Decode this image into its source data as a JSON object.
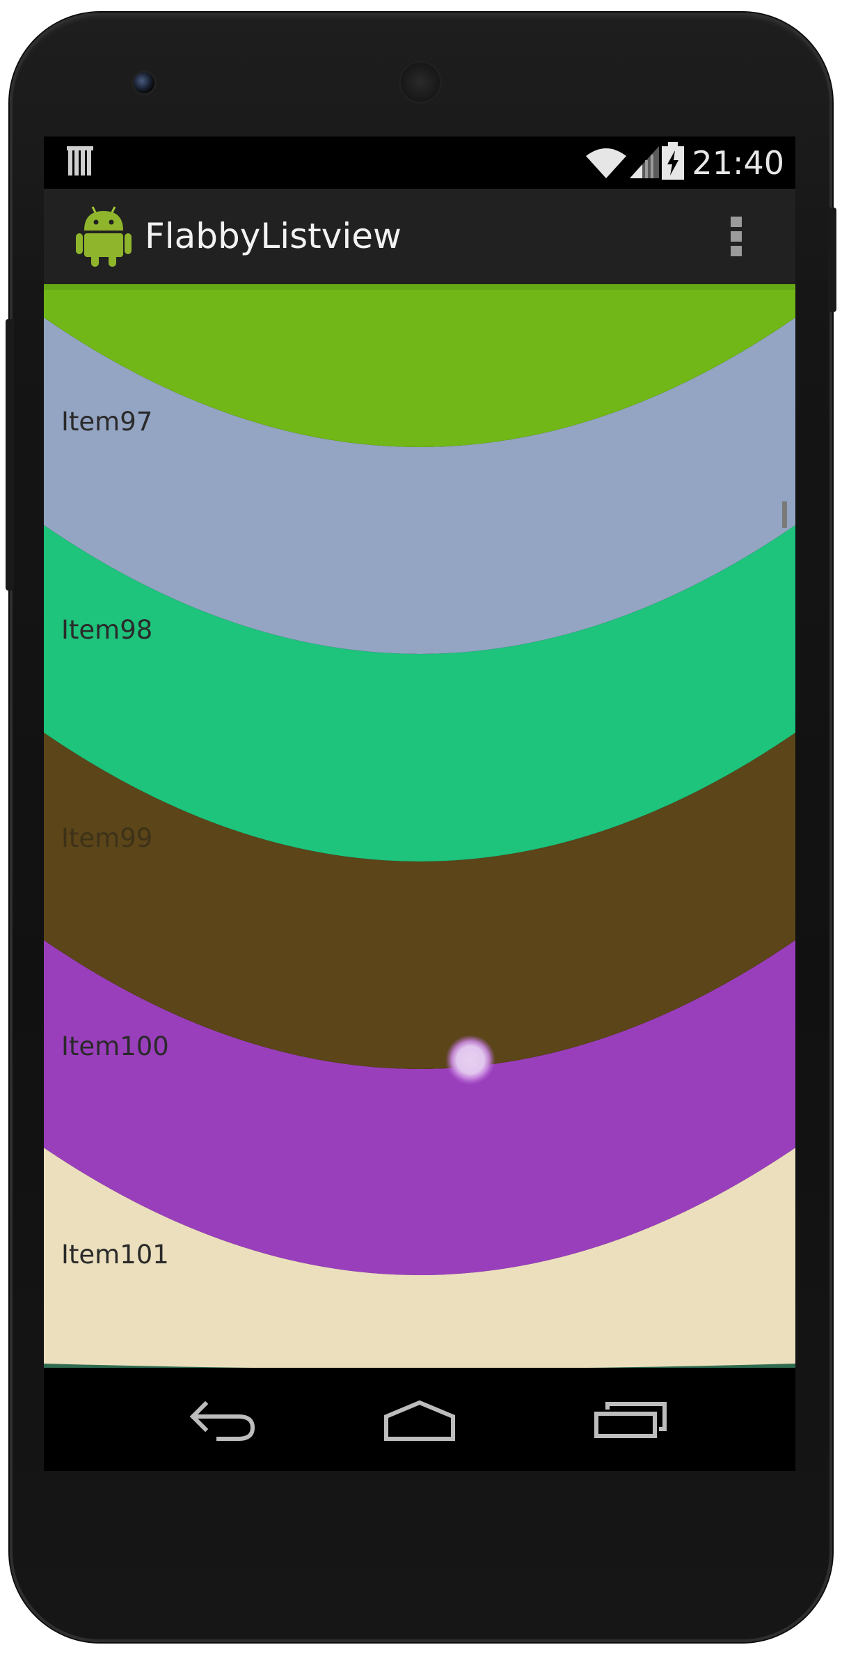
{
  "status_bar": {
    "time": "21:40",
    "icons": [
      "notification-bars-icon",
      "wifi-icon",
      "signal-icon",
      "battery-charging-icon"
    ]
  },
  "action_bar": {
    "title": "FlabbyListview",
    "app_icon": "android-robot-icon",
    "overflow_icon": "overflow-menu-icon"
  },
  "list": {
    "items": [
      {
        "label": "Item97",
        "color": "#94a5c4"
      },
      {
        "label": "Item98",
        "color": "#1ec37c"
      },
      {
        "label": "Item99",
        "color": "#5b4519"
      },
      {
        "label": "Item100",
        "color": "#9a3fbc"
      },
      {
        "label": "Item101",
        "color": "#ecdfbd"
      }
    ],
    "top_partial_color": "#70b717",
    "bottom_partial_color": "#2e6b50",
    "label_color": "#2a2a2a",
    "dark_label_color": "#3d3218"
  },
  "nav_bar": {
    "buttons": [
      "back-icon",
      "home-icon",
      "recent-apps-icon"
    ]
  }
}
